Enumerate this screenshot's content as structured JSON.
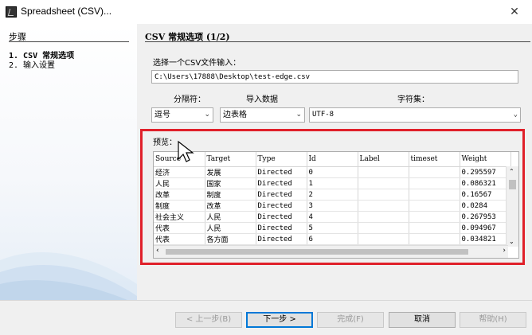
{
  "window": {
    "title": "Spreadsheet (CSV)...",
    "close_glyph": "✕"
  },
  "steps": {
    "title": "步骤",
    "items": [
      {
        "label": "1.  CSV 常规选项"
      },
      {
        "label": "2.  输入设置"
      }
    ]
  },
  "main": {
    "title": "CSV 常规选项 (1/2)",
    "file_prompt": "选择一个CSV文件输入：",
    "file_path": "C:\\Users\\17888\\Desktop\\test-edge.csv",
    "separator_label": "分隔符：",
    "separator_value": "逗号",
    "import_label": "导入数据",
    "import_value": "边表格",
    "charset_label": "字符集：",
    "charset_value": "UTF-8",
    "preview_label": "预览："
  },
  "preview": {
    "columns": [
      "Source",
      "Target",
      "Type",
      "Id",
      "Label",
      "timeset",
      "Weight"
    ],
    "rows": [
      [
        "经济",
        "发展",
        "Directed",
        "0",
        "",
        "",
        "0.295597"
      ],
      [
        "人民",
        "国家",
        "Directed",
        "1",
        "",
        "",
        "0.086321"
      ],
      [
        "改革",
        "制度",
        "Directed",
        "2",
        "",
        "",
        "0.16567"
      ],
      [
        "制度",
        "改革",
        "Directed",
        "3",
        "",
        "",
        "0.0284"
      ],
      [
        "社会主义",
        "人民",
        "Directed",
        "4",
        "",
        "",
        "0.267953"
      ],
      [
        "代表",
        "人民",
        "Directed",
        "5",
        "",
        "",
        "0.094967"
      ],
      [
        "代表",
        "各方面",
        "Directed",
        "6",
        "",
        "",
        "0.034821"
      ]
    ]
  },
  "buttons": {
    "back": "< 上一步(B)",
    "next": "下一步 >",
    "finish": "完成(F)",
    "cancel": "取消",
    "help": "帮助(H)"
  },
  "colors": {
    "highlight": "#e0202a",
    "accent": "#0078d7"
  },
  "icons": {
    "app": "spreadsheet-app-icon",
    "cursor": "mouse-pointer-icon"
  }
}
